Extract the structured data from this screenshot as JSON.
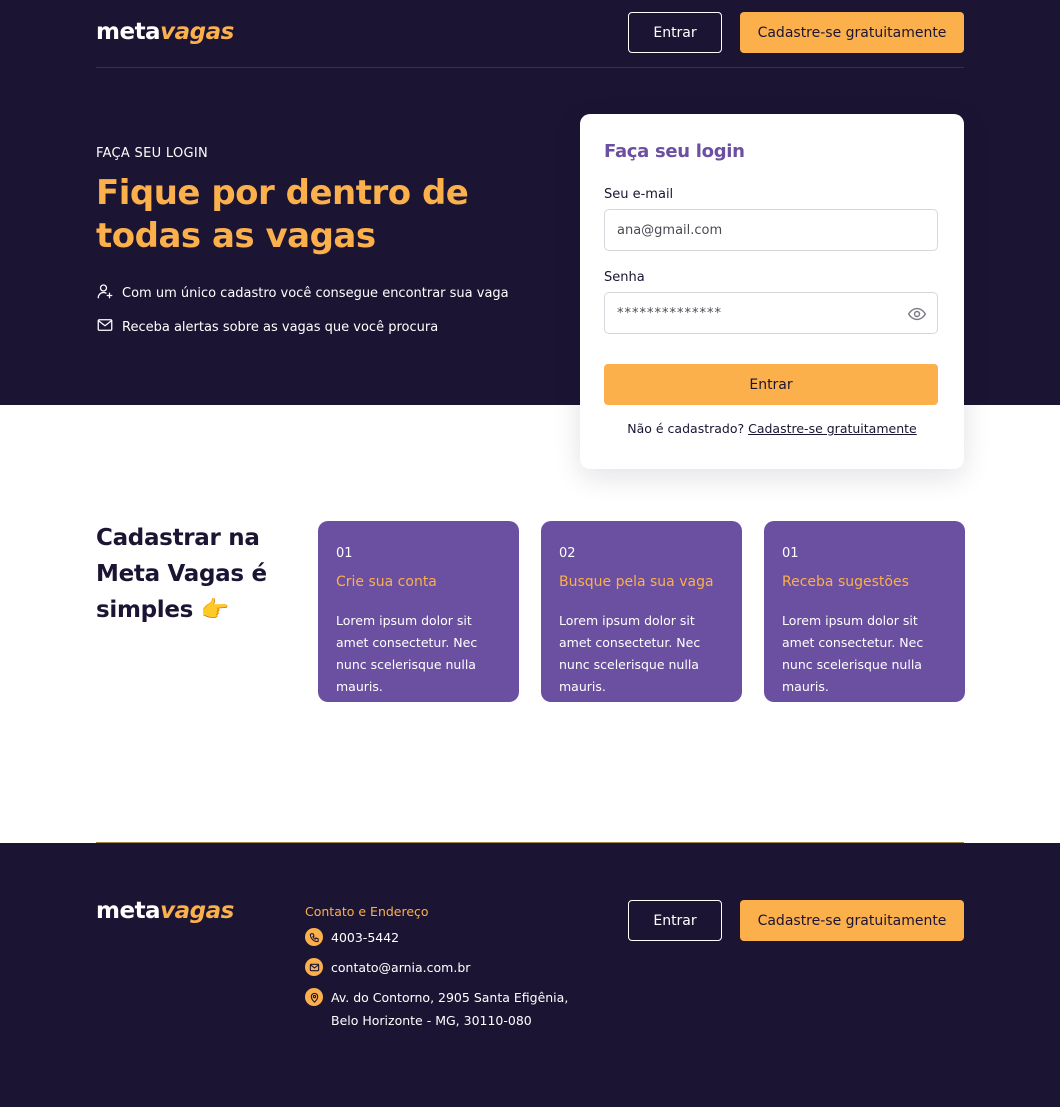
{
  "header": {
    "logo": {
      "text": "meta",
      "accent": "vagas"
    },
    "login_button": "Entrar",
    "signup_button": "Cadastre-se gratuitamente"
  },
  "hero": {
    "eyebrow": "FAÇA SEU LOGIN",
    "headline": "Fique por dentro de todas as vagas",
    "benefits": [
      {
        "icon": "user-plus-icon",
        "text": "Com um único cadastro você consegue encontrar sua vaga"
      },
      {
        "icon": "mail-icon",
        "text": "Receba alertas sobre as vagas que você procura"
      }
    ]
  },
  "login_card": {
    "title": "Faça seu login",
    "email_label": "Seu e-mail",
    "email_value": "ana@gmail.com",
    "password_label": "Senha",
    "password_value": "**************",
    "submit": "Entrar",
    "signup_prompt": "Não é cadastrado?",
    "signup_link": "Cadastre-se gratuitamente"
  },
  "steps": {
    "heading": "Cadastrar na Meta Vagas é simples 👉",
    "cards": [
      {
        "number": "01",
        "title": "Crie sua conta",
        "description": "Lorem ipsum dolor sit amet consectetur. Nec nunc scelerisque nulla mauris."
      },
      {
        "number": "02",
        "title": "Busque pela sua vaga",
        "description": "Lorem ipsum dolor sit amet consectetur. Nec nunc scelerisque nulla mauris."
      },
      {
        "number": "01",
        "title": "Receba sugestões",
        "description": "Lorem ipsum dolor sit amet consectetur. Nec nunc scelerisque nulla mauris."
      }
    ]
  },
  "footer": {
    "logo": {
      "text": "meta",
      "accent": "vagas"
    },
    "contact_title": "Contato e Endereço",
    "phone": "4003-5442",
    "email": "contato@arnia.com.br",
    "address_line1": "Av. do Contorno, 2905 Santa Efigênia,",
    "address_line2": "Belo Horizonte - MG, 30110-080",
    "login_button": "Entrar",
    "signup_button": "Cadastre-se gratuitamente"
  },
  "colors": {
    "dark": "#1c1433",
    "accent": "#fbb04c",
    "purple": "#6b4fa0"
  }
}
